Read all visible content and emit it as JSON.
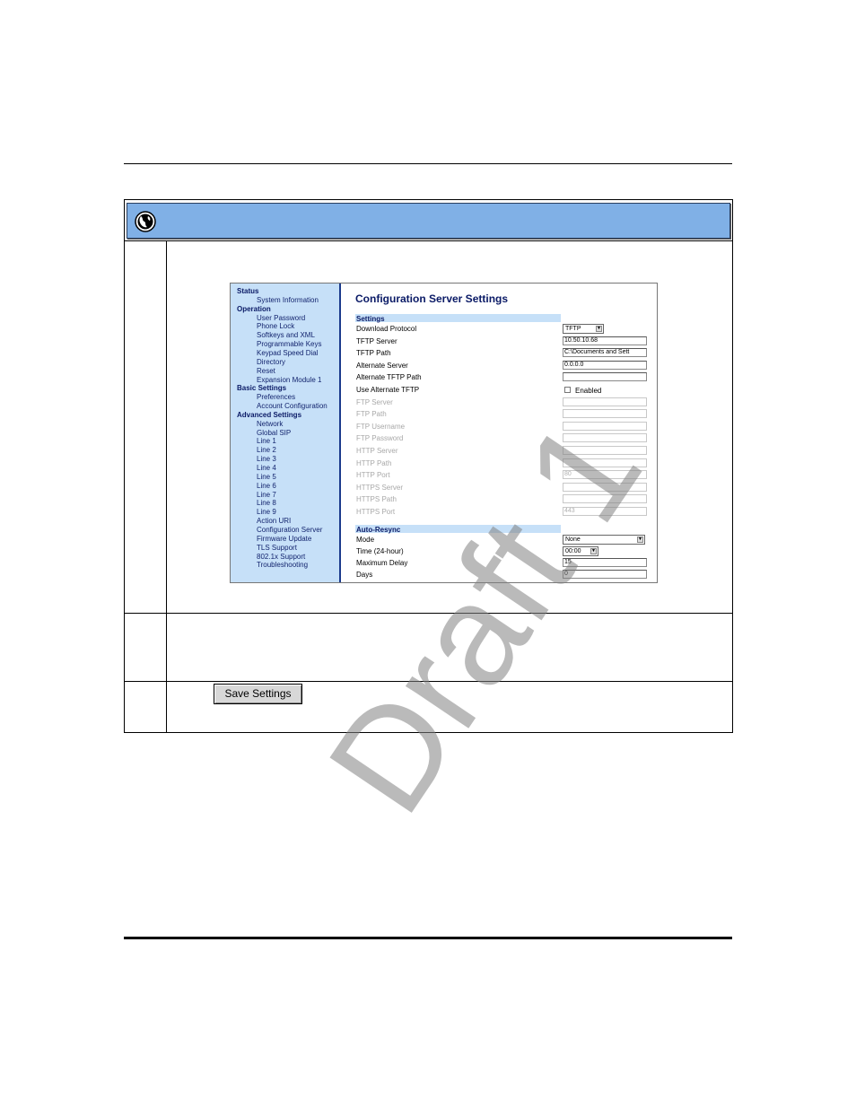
{
  "screenshot": {
    "title": "Configuration Server Settings",
    "nav": [
      {
        "label": "Status",
        "type": "heading"
      },
      {
        "label": "System Information",
        "type": "item"
      },
      {
        "label": "Operation",
        "type": "heading"
      },
      {
        "label": "User Password",
        "type": "item"
      },
      {
        "label": "Phone Lock",
        "type": "item"
      },
      {
        "label": "Softkeys and XML",
        "type": "item"
      },
      {
        "label": "Programmable Keys",
        "type": "item"
      },
      {
        "label": "Keypad Speed Dial",
        "type": "item"
      },
      {
        "label": "Directory",
        "type": "item"
      },
      {
        "label": "Reset",
        "type": "item"
      },
      {
        "label": "Expansion Module 1",
        "type": "item"
      },
      {
        "label": "Basic Settings",
        "type": "heading"
      },
      {
        "label": "Preferences",
        "type": "item"
      },
      {
        "label": "Account Configuration",
        "type": "item"
      },
      {
        "label": "Advanced Settings",
        "type": "heading"
      },
      {
        "label": "Network",
        "type": "item"
      },
      {
        "label": "Global SIP",
        "type": "item"
      },
      {
        "label": "Line 1",
        "type": "item"
      },
      {
        "label": "Line 2",
        "type": "item"
      },
      {
        "label": "Line 3",
        "type": "item"
      },
      {
        "label": "Line 4",
        "type": "item"
      },
      {
        "label": "Line 5",
        "type": "item"
      },
      {
        "label": "Line 6",
        "type": "item"
      },
      {
        "label": "Line 7",
        "type": "item"
      },
      {
        "label": "Line 8",
        "type": "item"
      },
      {
        "label": "Line 9",
        "type": "item"
      },
      {
        "label": "Action URI",
        "type": "item"
      },
      {
        "label": "Configuration Server",
        "type": "item"
      },
      {
        "label": "Firmware Update",
        "type": "item"
      },
      {
        "label": "TLS Support",
        "type": "item"
      },
      {
        "label": "802.1x Support",
        "type": "item"
      },
      {
        "label": "Troubleshooting",
        "type": "item"
      }
    ],
    "settings_section": "Settings",
    "settings_rows": [
      {
        "label": "Download Protocol",
        "kind": "select",
        "value": "TFTP",
        "disabled": false
      },
      {
        "label": "TFTP Server",
        "kind": "text",
        "value": "10.50.10.68",
        "disabled": false
      },
      {
        "label": "TFTP Path",
        "kind": "text",
        "value": "C:\\Documents and Sett",
        "disabled": false
      },
      {
        "label": "Alternate Server",
        "kind": "text",
        "value": "0.0.0.0",
        "disabled": false
      },
      {
        "label": "Alternate TFTP Path",
        "kind": "text",
        "value": "",
        "disabled": false
      },
      {
        "label": "Use Alternate TFTP",
        "kind": "checkbox",
        "value": "Enabled",
        "disabled": false
      },
      {
        "label": "FTP Server",
        "kind": "text",
        "value": "",
        "disabled": true
      },
      {
        "label": "FTP Path",
        "kind": "text",
        "value": "",
        "disabled": true
      },
      {
        "label": "FTP Username",
        "kind": "text",
        "value": "",
        "disabled": true
      },
      {
        "label": "FTP Password",
        "kind": "text",
        "value": "",
        "disabled": true
      },
      {
        "label": "HTTP Server",
        "kind": "text",
        "value": "",
        "disabled": true
      },
      {
        "label": "HTTP Path",
        "kind": "text",
        "value": "",
        "disabled": true
      },
      {
        "label": "HTTP Port",
        "kind": "text",
        "value": "80",
        "disabled": true
      },
      {
        "label": "HTTPS Server",
        "kind": "text",
        "value": "",
        "disabled": true
      },
      {
        "label": "HTTPS Path",
        "kind": "text",
        "value": "",
        "disabled": true
      },
      {
        "label": "HTTPS Port",
        "kind": "text",
        "value": "443",
        "disabled": true
      }
    ],
    "autoresync_section": "Auto-Resync",
    "autoresync_rows": [
      {
        "label": "Mode",
        "kind": "select-wide",
        "value": "None"
      },
      {
        "label": "Time (24-hour)",
        "kind": "select",
        "value": "00:00"
      },
      {
        "label": "Maximum Delay",
        "kind": "text",
        "value": "15"
      },
      {
        "label": "Days",
        "kind": "text",
        "value": "0"
      }
    ]
  },
  "save_button_label": "Save Settings",
  "watermark": "Draft 1"
}
